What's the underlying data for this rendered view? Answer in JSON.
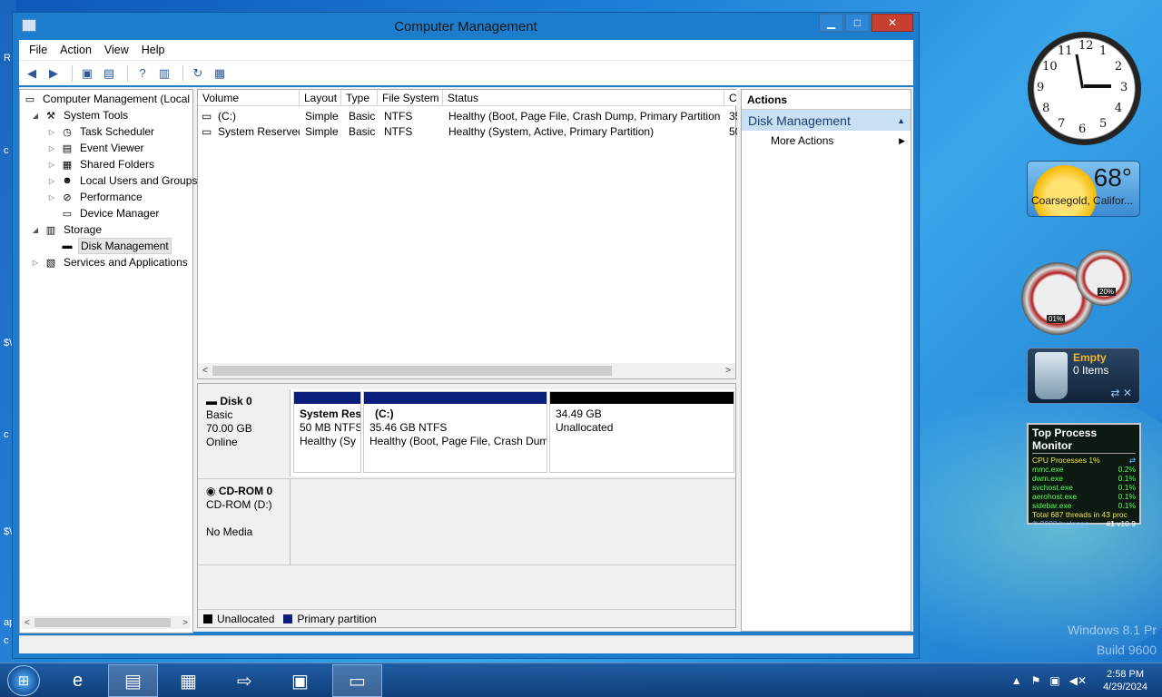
{
  "window": {
    "title": "Computer Management",
    "controls": {
      "minimize": "▁",
      "maximize": "□",
      "close": "✕"
    }
  },
  "menu": [
    "File",
    "Action",
    "View",
    "Help"
  ],
  "toolbar_icons": [
    "back-arrow-icon",
    "forward-arrow-icon",
    "folder-up-icon",
    "show-hide-tree-icon",
    "help-icon",
    "console-icon",
    "refresh-icon",
    "export-list-icon"
  ],
  "tree": {
    "root": "Computer Management (Local",
    "items": [
      {
        "label": "System Tools",
        "level": 1,
        "expander": "◢",
        "icon": "tools-icon",
        "glyph": "⚒"
      },
      {
        "label": "Task Scheduler",
        "level": 2,
        "expander": "▷",
        "icon": "clock-icon",
        "glyph": "◷"
      },
      {
        "label": "Event Viewer",
        "level": 2,
        "expander": "▷",
        "icon": "event-viewer-icon",
        "glyph": "▤"
      },
      {
        "label": "Shared Folders",
        "level": 2,
        "expander": "▷",
        "icon": "shared-folder-icon",
        "glyph": "▦"
      },
      {
        "label": "Local Users and Groups",
        "level": 2,
        "expander": "▷",
        "icon": "users-icon",
        "glyph": "☻"
      },
      {
        "label": "Performance",
        "level": 2,
        "expander": "▷",
        "icon": "performance-icon",
        "glyph": "⊘"
      },
      {
        "label": "Device Manager",
        "level": 2,
        "expander": "",
        "icon": "device-manager-icon",
        "glyph": "▭"
      },
      {
        "label": "Storage",
        "level": 1,
        "expander": "◢",
        "icon": "storage-icon",
        "glyph": "▥"
      },
      {
        "label": "Disk Management",
        "level": 2,
        "expander": "",
        "icon": "disk-icon",
        "glyph": "▬",
        "selected": true
      },
      {
        "label": "Services and Applications",
        "level": 1,
        "expander": "▷",
        "icon": "services-icon",
        "glyph": "▧"
      }
    ]
  },
  "volumes": {
    "columns": [
      "Volume",
      "Layout",
      "Type",
      "File System",
      "Status",
      "C"
    ],
    "rows": [
      {
        "volume": "(C:)",
        "layout": "Simple",
        "type": "Basic",
        "fs": "NTFS",
        "status": "Healthy (Boot, Page File, Crash Dump, Primary Partition)",
        "c": "35"
      },
      {
        "volume": "System Reserved",
        "layout": "Simple",
        "type": "Basic",
        "fs": "NTFS",
        "status": "Healthy (System, Active, Primary Partition)",
        "c": "50"
      }
    ]
  },
  "disks": {
    "disk0": {
      "name": "Disk 0",
      "type": "Basic",
      "size": "70.00 GB",
      "state": "Online",
      "partitions": [
        {
          "title": "System Res",
          "line2": "50 MB NTFS",
          "line3": "Healthy (Sy",
          "kind": "primary"
        },
        {
          "title": "(C:)",
          "line2": "35.46 GB NTFS",
          "line3": "Healthy (Boot, Page File, Crash Dum",
          "kind": "primary"
        },
        {
          "title": "",
          "line2": "34.49 GB",
          "line3": "Unallocated",
          "kind": "unallocated"
        }
      ]
    },
    "cdrom0": {
      "name": "CD-ROM 0",
      "line2": "CD-ROM (D:)",
      "line3": "No Media"
    }
  },
  "legend": {
    "unallocated": "Unallocated",
    "primary": "Primary partition"
  },
  "colors": {
    "primary": "#0a1e7a",
    "unallocated": "#000000",
    "accent": "#1e7ccc"
  },
  "actions": {
    "header": "Actions",
    "section": "Disk Management",
    "more": "More Actions"
  },
  "gadgets": {
    "clock_numbers": [
      "12",
      "1",
      "2",
      "3",
      "4",
      "5",
      "6",
      "7",
      "8",
      "9",
      "10",
      "11"
    ],
    "weather": {
      "temp": "68°",
      "city": "Coarsegold, Califor..."
    },
    "meter": {
      "cpu": "01%",
      "mem": "20%"
    },
    "recycle": {
      "status": "Empty",
      "items": "0 Items"
    },
    "procmon": {
      "title": "Top Process Monitor",
      "header": "CPU Processes 1%",
      "rows": [
        {
          "name": "mmc.exe",
          "pct": "0.2%"
        },
        {
          "name": "dwm.exe",
          "pct": "0.1%"
        },
        {
          "name": "svchost.exe",
          "pct": "0.1%"
        },
        {
          "name": "aerohost.exe",
          "pct": "0.1%"
        },
        {
          "name": "sidebar.exe",
          "pct": "0.1%"
        }
      ],
      "total": "Total 687 threads in 43 proc",
      "footer_link": "© 2023 by Igogo",
      "footer_rank": "#1",
      "footer_ver": "v10.9"
    }
  },
  "desktop": {
    "watermark_line1": "Windows 8.1 Pr",
    "watermark_line2": "Build 9600",
    "left_edge_chars": [
      "R",
      "c",
      "$\\",
      "c",
      "$\\",
      "ap",
      "c"
    ]
  },
  "taskbar": {
    "time": "2:58 PM",
    "date": "4/29/2024"
  }
}
